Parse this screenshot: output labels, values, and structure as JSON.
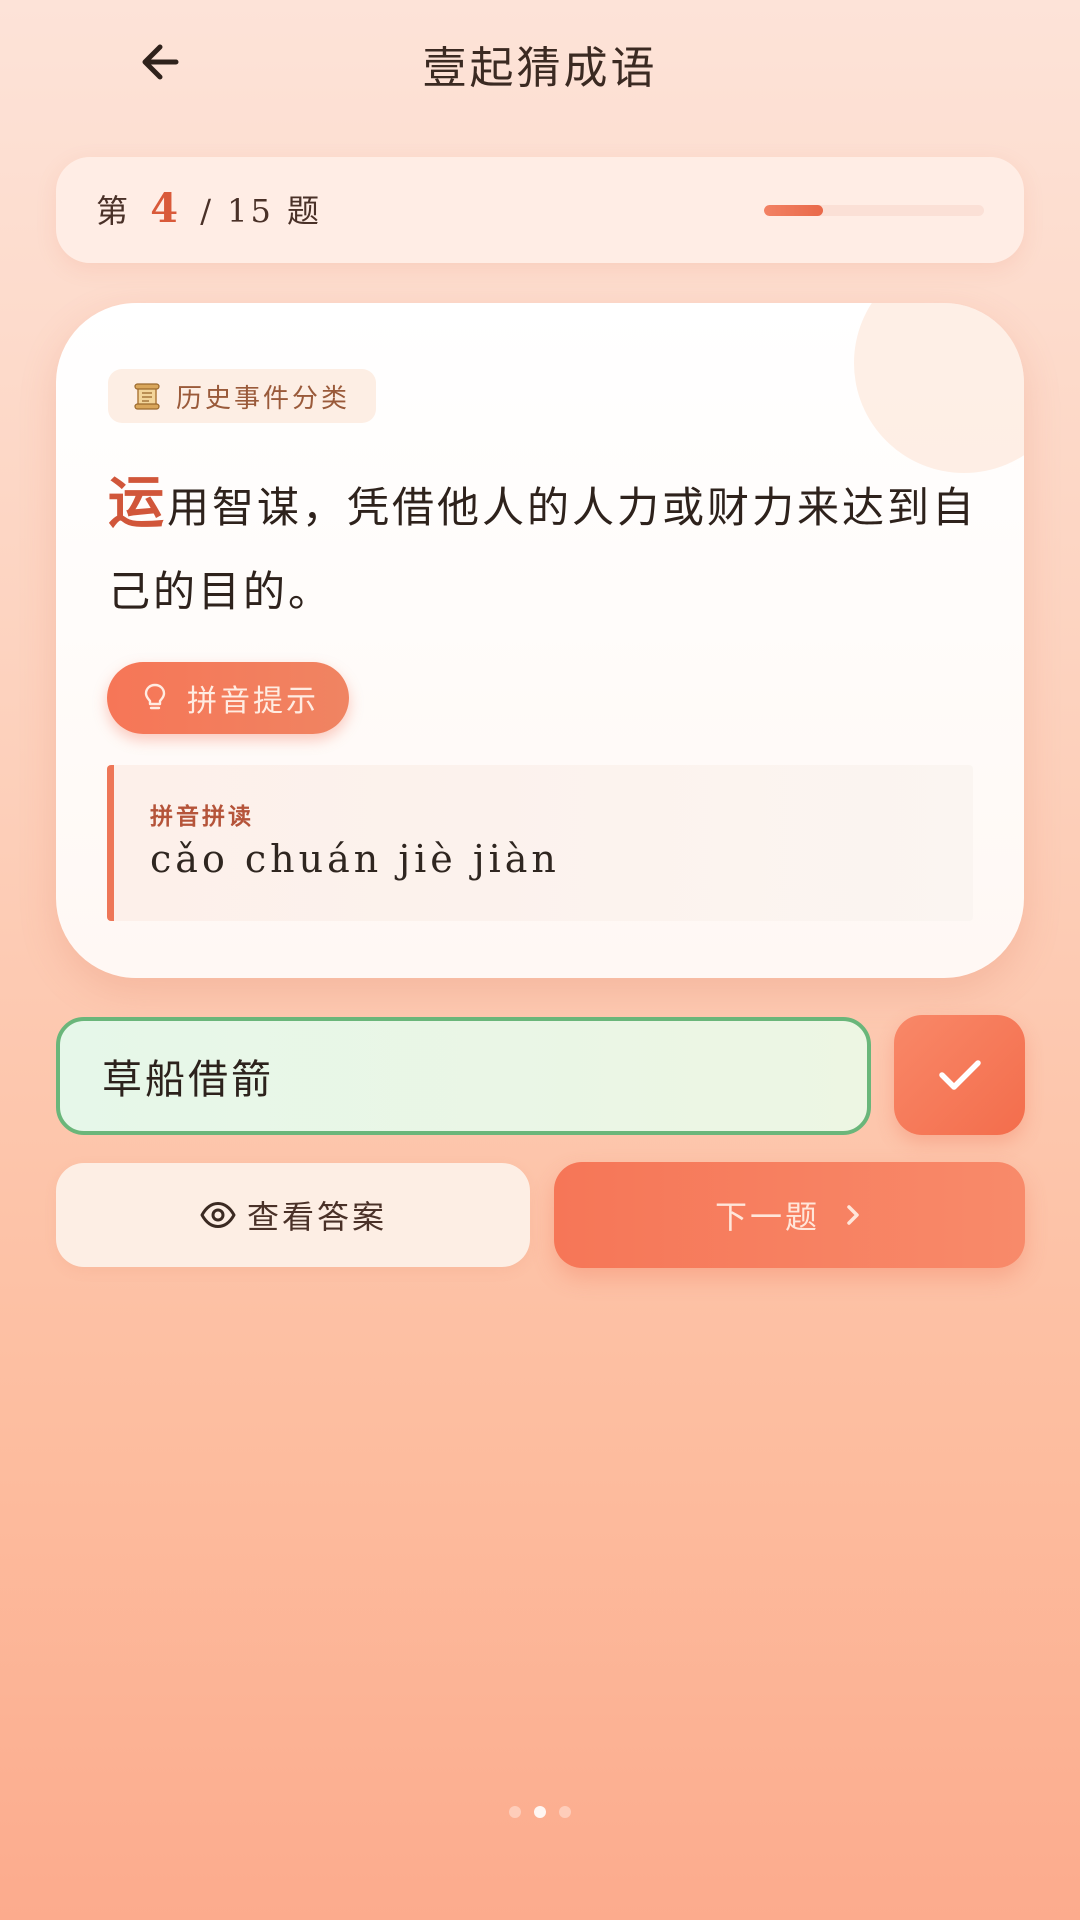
{
  "header": {
    "title": "壹起猜成语",
    "back_icon": "arrow-left-icon"
  },
  "progress": {
    "prefix": "第",
    "current": "4",
    "separator": "/ 15",
    "suffix": "题",
    "total": 15,
    "fraction": 0.27
  },
  "question": {
    "category_icon": "scroll-icon",
    "category": "历史事件分类",
    "first_char": "运",
    "text": "用智谋，凭借他人的人力或财力来达到自己的目的。",
    "hint_button": "拼音提示",
    "hint_icon": "lightbulb-icon",
    "pinyin_label": "拼音拼读",
    "pinyin": "cǎo chuán jiè jiàn"
  },
  "answer": {
    "value": "草船借箭",
    "submit_icon": "checkmark-icon"
  },
  "actions": {
    "view_answer": "查看答案",
    "view_answer_icon": "eye-icon",
    "next": "下一题",
    "next_icon": "chevron-right-icon"
  },
  "pager": {
    "count": 3,
    "active": 2
  },
  "colors": {
    "accent": "#F3704F",
    "accent_text": "#D1563A",
    "correct_border": "#6AB67A",
    "correct_bg": "#E6F7E9"
  }
}
